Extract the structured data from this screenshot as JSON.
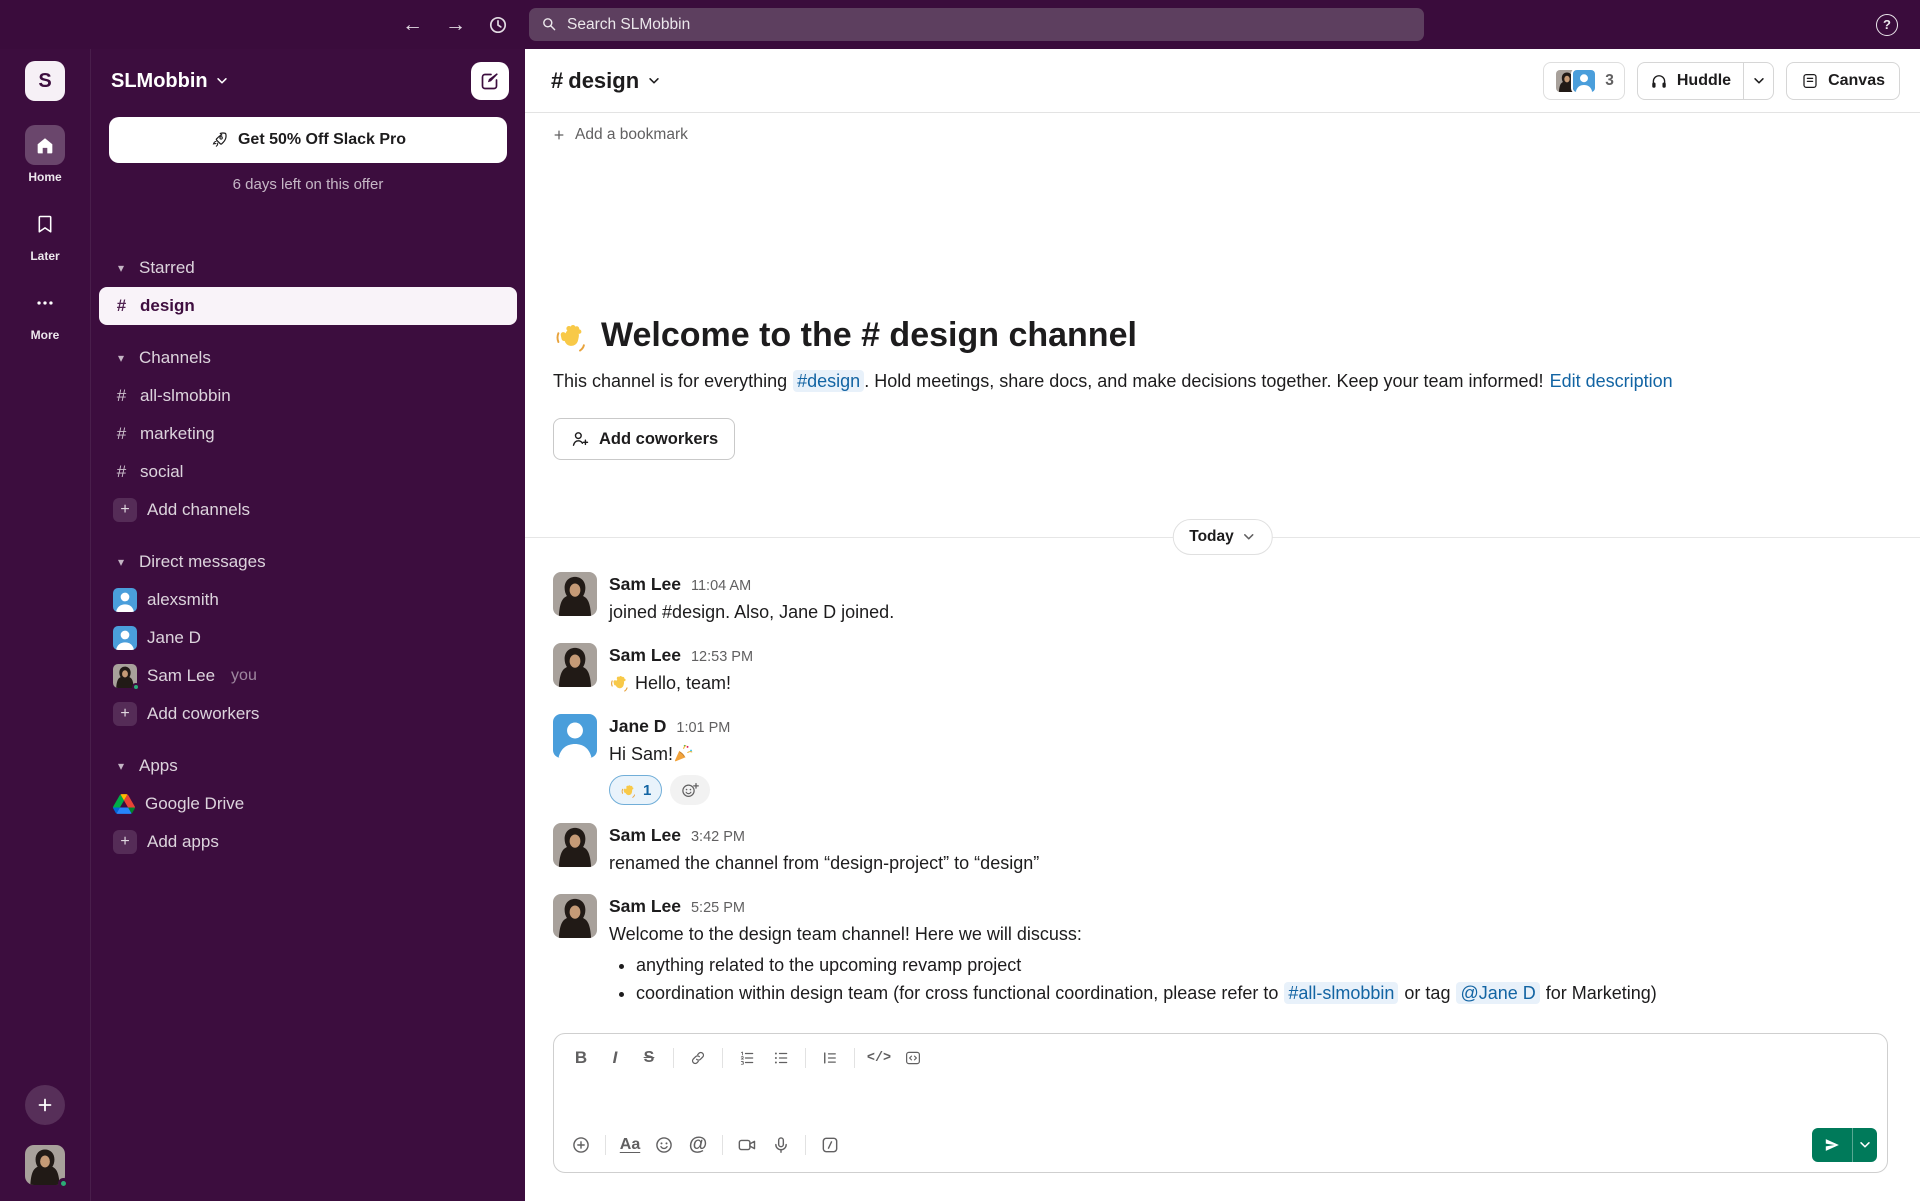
{
  "glyphs": {
    "hash": "#",
    "plus": "+",
    "question": "?",
    "at": "@",
    "back_arrow": "←",
    "forward_arrow": "→",
    "caret": "▾"
  },
  "colors": {
    "sidebar_bg": "#3c0d3e",
    "accent_green": "#007a5a",
    "link_blue": "#1264a3",
    "presence_green": "#2bac76"
  },
  "topbar": {
    "search_placeholder": "Search SLMobbin"
  },
  "rail": {
    "workspace_initial": "S",
    "items": [
      {
        "label": "Home"
      },
      {
        "label": "Later"
      },
      {
        "label": "More"
      }
    ]
  },
  "sidebar": {
    "workspace_name": "SLMobbin",
    "promo": {
      "button_label": "Get 50% Off Slack Pro",
      "subtext": "6 days left on this offer"
    },
    "sections": [
      {
        "label": "Starred",
        "items": [
          {
            "label": "design",
            "selected": true
          }
        ]
      },
      {
        "label": "Channels",
        "items": [
          {
            "label": "all-slmobbin"
          },
          {
            "label": "marketing"
          },
          {
            "label": "social"
          },
          {
            "label": "Add channels"
          }
        ]
      },
      {
        "label": "Direct messages",
        "items": [
          {
            "label": "alexsmith"
          },
          {
            "label": "Jane D"
          },
          {
            "label": "Sam Lee",
            "suffix": "you"
          },
          {
            "label": "Add coworkers"
          }
        ]
      },
      {
        "label": "Apps",
        "items": [
          {
            "label": "Google Drive"
          },
          {
            "label": "Add apps"
          }
        ]
      }
    ]
  },
  "header": {
    "channel_name": "design",
    "member_count": "3",
    "huddle_label": "Huddle",
    "canvas_label": "Canvas",
    "add_bookmark_label": "Add a bookmark"
  },
  "welcome": {
    "title": "Welcome to the # design channel",
    "desc_pre": "This channel is for everything",
    "desc_chip": "#design",
    "desc_post": ". Hold meetings, share docs, and make decisions together. Keep your team informed!",
    "edit_link": "Edit description",
    "add_coworkers_label": "Add coworkers"
  },
  "date_divider": {
    "label": "Today"
  },
  "messages": [
    {
      "user": "Sam Lee",
      "time": "11:04 AM",
      "text": "joined #design. Also, Jane D joined."
    },
    {
      "user": "Sam Lee",
      "time": "12:53 PM",
      "text": "Hello, team!"
    },
    {
      "user": "Jane D",
      "time": "1:01 PM",
      "text": "Hi Sam!",
      "reaction_count": "1"
    },
    {
      "user": "Sam Lee",
      "time": "3:42 PM",
      "text": "renamed the channel from “design-project” to “design”"
    },
    {
      "user": "Sam Lee",
      "time": "5:25 PM",
      "text": "Welcome to the design team channel! Here we will discuss:",
      "bullets": {
        "b1": "anything related to the upcoming revamp project",
        "b2_pre": "coordination within design team (for cross functional coordination, please refer to",
        "b2_chip1": "#all-slmobbin",
        "b2_mid": "or tag",
        "b2_chip2": "@Jane D",
        "b2_post": "for Marketing)"
      }
    }
  ],
  "composer": {
    "bold": "B",
    "italic": "I",
    "strike": "S",
    "aa": "Aa",
    "code": "</>"
  }
}
